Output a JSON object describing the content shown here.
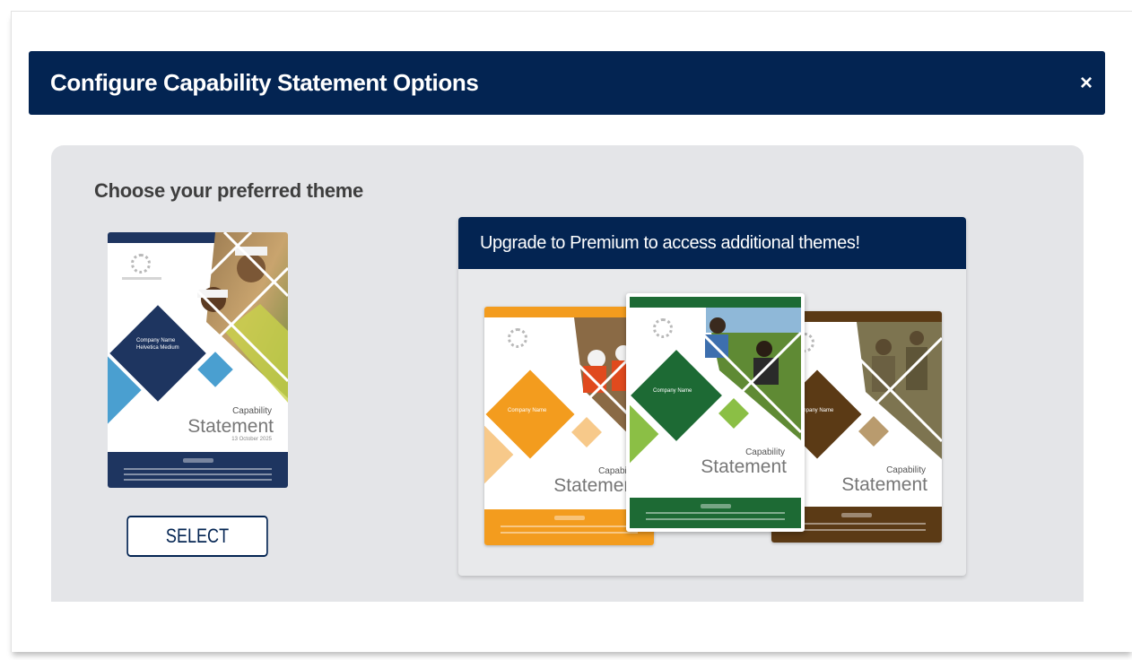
{
  "modal": {
    "title": "Configure Capability Statement Options",
    "close_label": "×"
  },
  "theme_chooser": {
    "heading": "Choose your preferred theme",
    "select_label": "SELECT"
  },
  "premium": {
    "banner": "Upgrade to Premium to access additional themes!"
  },
  "themes": [
    {
      "name": "navy",
      "cover_company": "Company Name",
      "cover_subtitle": "Helvetica Medium",
      "cover_capability": "Capability",
      "cover_statement": "Statement",
      "cover_date": "13 October 2025",
      "accent_color": "#1e3560",
      "secondary_color": "#4a9fd0"
    },
    {
      "name": "orange",
      "cover_company": "Company Name",
      "cover_capability": "Capability",
      "cover_statement": "Statement",
      "accent_color": "#f39c1e",
      "secondary_color": "#f7c98a"
    },
    {
      "name": "green",
      "cover_company": "Company Name",
      "cover_capability": "Capability",
      "cover_statement": "Statement",
      "accent_color": "#1d6a34",
      "secondary_color": "#8bbf45"
    },
    {
      "name": "brown",
      "cover_company": "Company Name",
      "cover_capability": "Capability",
      "cover_statement": "Statement",
      "accent_color": "#5b3a15",
      "secondary_color": "#b99b6e"
    }
  ]
}
